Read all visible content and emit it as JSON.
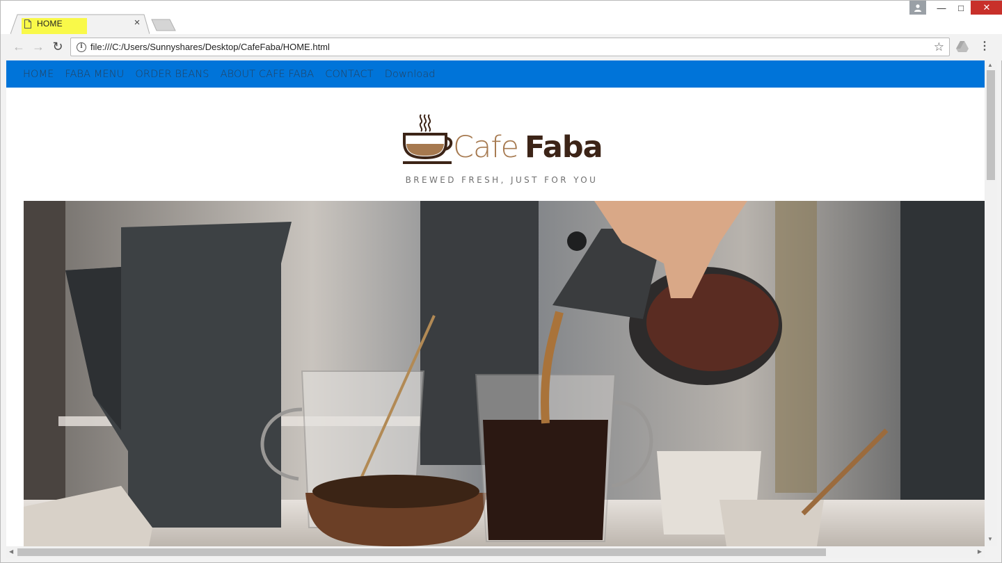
{
  "browser": {
    "tab_title": "HOME",
    "tab_close": "×",
    "url": "file:///C:/Users/Sunnyshares/Desktop/CafeFaba/HOME.html",
    "window_controls": {
      "minimize": "—",
      "maximize": "□",
      "close": "✕"
    },
    "icons": {
      "back": "arrow-left-icon",
      "forward": "arrow-right-icon",
      "reload": "reload-icon",
      "info": "info-icon",
      "bookmark": "star-icon",
      "extension": "drive-icon",
      "menu": "kebab-menu-icon",
      "user": "user-icon"
    }
  },
  "site": {
    "nav": [
      "HOME",
      "FABA MENU",
      "ORDER BEANS",
      "ABOUT CAFE FABA",
      "CONTACT",
      "Download"
    ],
    "logo": {
      "cafe": "Cafe",
      "faba": "Faba"
    },
    "tagline": "BREWED FRESH, JUST FOR YOU",
    "colors": {
      "nav_bg": "#0074d9",
      "nav_text": "#25415c",
      "logo_light": "#a6794f",
      "logo_dark": "#3c2417"
    }
  }
}
